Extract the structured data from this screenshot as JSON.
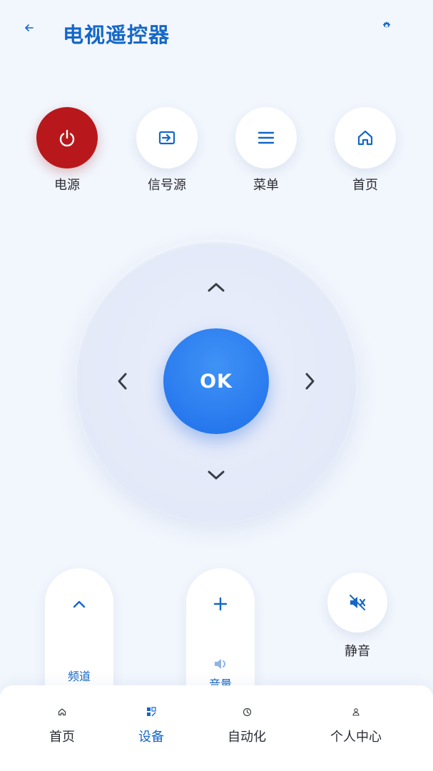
{
  "header": {
    "title": "电视遥控器",
    "back_icon": "arrow-left-icon",
    "settings_icon": "gear-icon"
  },
  "quick_buttons": [
    {
      "label": "电源",
      "icon": "power-icon",
      "color": "#b8181b"
    },
    {
      "label": "信号源",
      "icon": "input-source-icon"
    },
    {
      "label": "菜单",
      "icon": "menu-icon"
    },
    {
      "label": "首页",
      "icon": "home-icon"
    }
  ],
  "dpad": {
    "ok_label": "OK"
  },
  "controls": {
    "channel": {
      "label": "频道",
      "up_icon": "chevron-up-icon"
    },
    "volume": {
      "label": "音量",
      "up_icon": "plus-icon",
      "speaker_icon": "speaker-icon"
    },
    "mute": {
      "label": "静音",
      "icon": "mute-icon"
    }
  },
  "bottom_nav": {
    "items": [
      {
        "label": "首页",
        "icon": "home-icon"
      },
      {
        "label": "设备",
        "icon": "devices-icon",
        "active": true
      },
      {
        "label": "自动化",
        "icon": "clock-icon"
      },
      {
        "label": "个人中心",
        "icon": "person-icon"
      }
    ]
  },
  "colors": {
    "accent": "#1467c8",
    "ok_button": "#2e7ff0",
    "power": "#b8181b",
    "background": "#f2f6fd"
  }
}
